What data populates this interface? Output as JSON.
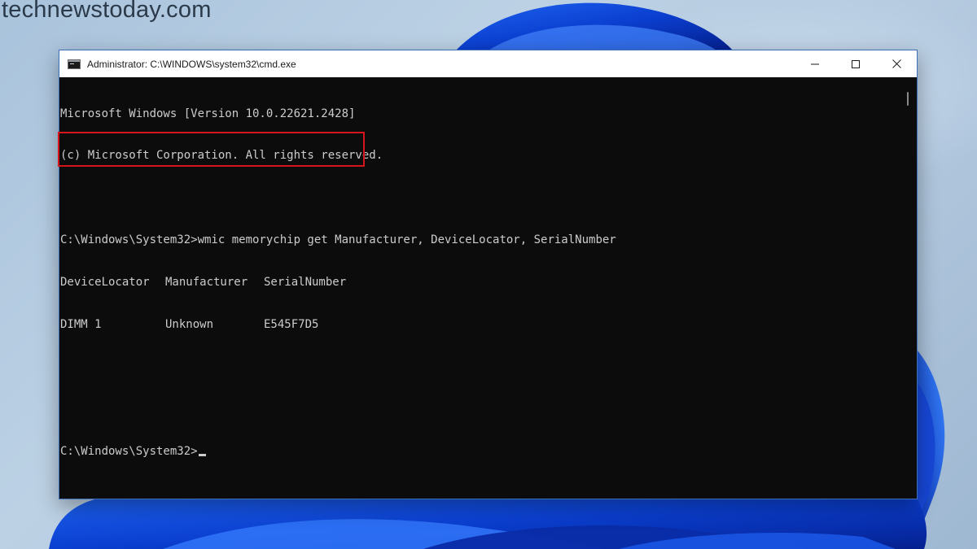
{
  "watermark": "technewstoday.com",
  "window": {
    "title": "Administrator: C:\\WINDOWS\\system32\\cmd.exe",
    "icon": "cmd-icon",
    "controls": {
      "minimize": "minimize-icon",
      "maximize": "maximize-icon",
      "close": "close-icon"
    }
  },
  "console": {
    "lines": [
      "Microsoft Windows [Version 10.0.22621.2428]",
      "(c) Microsoft Corporation. All rights reserved.",
      "",
      "C:\\Windows\\System32>wmic memorychip get Manufacturer, DeviceLocator, SerialNumber"
    ],
    "table": {
      "headers": [
        "DeviceLocator",
        "Manufacturer",
        "SerialNumber"
      ],
      "rows": [
        [
          "DIMM 1",
          "Unknown",
          "E545F7D5"
        ]
      ]
    },
    "prompt": "C:\\Windows\\System32>"
  },
  "colors": {
    "console_bg": "#0c0c0c",
    "console_text": "#cccccc",
    "highlight": "#d4161c",
    "window_border": "#3c6fb8"
  }
}
